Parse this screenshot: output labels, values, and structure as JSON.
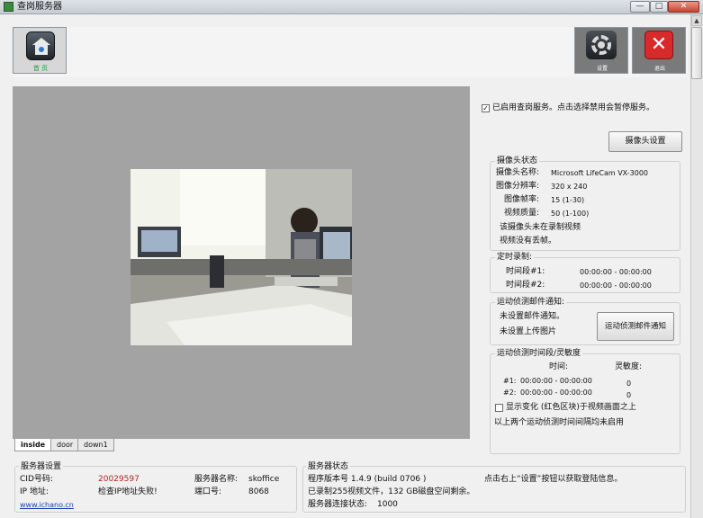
{
  "window": {
    "title": "查岗服务器",
    "min": "—",
    "max": "□",
    "close": "✕"
  },
  "toolbar": {
    "home_label": "首 页",
    "settings_label": "设置",
    "exit_label": "退出"
  },
  "side": {
    "enable_service": "已启用查岗服务。点击选择禁用会暂停服务。",
    "camera_settings_button": "摄像头设置",
    "camera_status": {
      "title": "摄像头状态",
      "name_label": "摄像头名称:",
      "name_value": "Microsoft LifeCam VX-3000",
      "resolution_label": "图像分辨率:",
      "resolution_value": "320 x 240",
      "fps_label": "图像帧率:",
      "fps_value": "15 (1-30)",
      "quality_label": "视频质量:",
      "quality_value": "50 (1-100)",
      "not_recording": "该摄像头未在录制视频",
      "no_mic": "视频没有丢帧。"
    },
    "timed_recording": {
      "title": "定时录制:",
      "period1_label": "时间段#1:",
      "period1_value": "00:00:00 - 00:00:00",
      "period2_label": "时间段#2:",
      "period2_value": "00:00:00 - 00:00:00"
    },
    "motion_email": {
      "title": "运动侦测邮件通知:",
      "no_email": "未设置邮件通知。",
      "no_upload": "未设置上传图片",
      "button": "运动侦测邮件通知"
    },
    "motion_period": {
      "title": "运动侦测时间段/灵敏度",
      "time_header": "时间:",
      "sensitivity_header": "灵敏度:",
      "row1_label": "#1:",
      "row1_time": "00:00:00 - 00:00:00",
      "row1_sens": "0",
      "row2_label": "#2:",
      "row2_time": "00:00:00 - 00:00:00",
      "row2_sens": "0",
      "show_changes": "显示变化 (红色区块)于视频画面之上",
      "note": "以上两个运动侦测时间间隔均未启用"
    }
  },
  "tabs": [
    "inside",
    "door",
    "down1"
  ],
  "server_settings": {
    "title": "服务器设置",
    "cid_label": "CID号码:",
    "cid_value": "20029597",
    "ip_label": "IP 地址:",
    "ip_value": "检查IP地址失败!",
    "name_label": "服务器名称:",
    "name_value": "skoffice",
    "port_label": "端口号:",
    "port_value": "8068",
    "link": "www.ichano.cn"
  },
  "server_status": {
    "title": "服务器状态",
    "version": "程序版本号 1.4.9  (build 0706 )",
    "recorded": "已录制255视频文件，132 GB磁盘空间剩余。",
    "connections_label": "服务器连接状态:",
    "connections_value": "1000",
    "hint": "点击右上“设置”按钮以获取登陆信息。"
  },
  "colors": {
    "cid": "#b22222",
    "link": "#1a3fb5",
    "accent_green": "#1f9b2b"
  }
}
